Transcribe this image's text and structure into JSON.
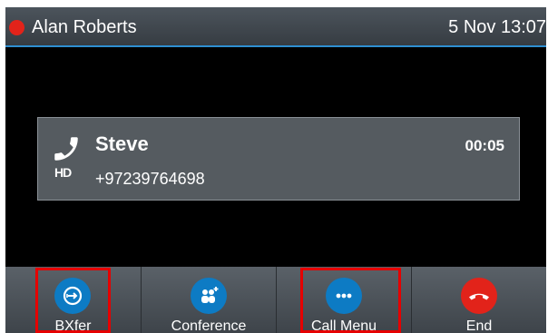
{
  "status_bar": {
    "account_name": "Alan Roberts",
    "datetime": "5 Nov 13:07",
    "status_color": "#e2231a",
    "status_icon": "red-status-dot-icon"
  },
  "active_call": {
    "caller_name": "Steve",
    "caller_number": "+97239764698",
    "duration": "00:05",
    "hd_label": "HD",
    "icon": "phone-handset-icon"
  },
  "softkeys": [
    {
      "label": "BXfer",
      "icon": "blind-transfer-icon",
      "color": "#0d7bc4",
      "highlighted": true
    },
    {
      "label": "Conference",
      "icon": "conference-add-icon",
      "color": "#0d7bc4",
      "highlighted": false
    },
    {
      "label": "Call Menu",
      "icon": "more-dots-icon",
      "color": "#0d7bc4",
      "highlighted": true
    },
    {
      "label": "End",
      "icon": "hang-up-icon",
      "color": "#e2231a",
      "highlighted": false
    }
  ],
  "colors": {
    "accent": "#2e8fd1",
    "highlight_box": "#e60000"
  }
}
